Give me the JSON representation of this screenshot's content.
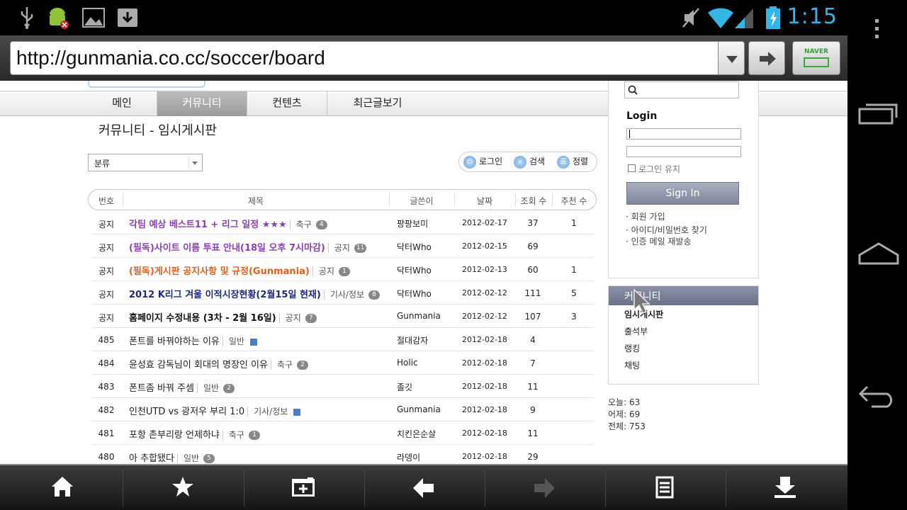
{
  "status_bar": {
    "time": "1:15",
    "icons": [
      "usb-icon",
      "android-debug-icon",
      "image-icon",
      "download-icon",
      "mute-icon",
      "wifi-icon",
      "signal-icon",
      "battery-charging-icon"
    ]
  },
  "url_bar": {
    "url": "http://gunmania.co.cc/soccer/board",
    "naver_label": "NAVER"
  },
  "nav": {
    "tabs": [
      {
        "label": "메인",
        "active": false
      },
      {
        "label": "커뮤니티",
        "active": true
      },
      {
        "label": "컨텐츠",
        "active": false
      },
      {
        "label": "최근글보기",
        "active": false
      }
    ]
  },
  "board": {
    "title": "커뮤니티 - 임시게시판",
    "category_select": "분류",
    "tools": {
      "login": "로그인",
      "search": "검색",
      "sort": "정렬"
    },
    "columns": {
      "no": "번호",
      "title": "제목",
      "author": "글쓴이",
      "date": "날짜",
      "views": "조회 수",
      "recommend": "추천 수"
    },
    "rows": [
      {
        "no": "공지",
        "title": "각팀 예상 베스트11 + 리그 일정 ★★★",
        "category": "축구",
        "comments": "4",
        "author": "팡팡보미",
        "date": "2012-02-17",
        "views": "37",
        "recommend": "1",
        "color": "#8a3fb5",
        "bold": true
      },
      {
        "no": "공지",
        "title": "(필독)사이트 이름 투표 안내(18일 오후 7시마감)",
        "category": "공지",
        "comments": "11",
        "author": "닥터Who",
        "date": "2012-02-15",
        "views": "69",
        "recommend": "",
        "color": "#8a3fb5",
        "bold": true
      },
      {
        "no": "공지",
        "title": "(필독)게시판 공지사항 및 규정(Gunmania)",
        "category": "공지",
        "comments": "1",
        "author": "닥터Who",
        "date": "2012-02-13",
        "views": "60",
        "recommend": "1",
        "color": "#e0601e",
        "bold": true
      },
      {
        "no": "공지",
        "title": "2012 K리그 겨울 이적시장현황(2월15일 현재)",
        "category": "기사/정보",
        "comments": "8",
        "author": "닥터Who",
        "date": "2012-02-12",
        "views": "111",
        "recommend": "5",
        "color": "#1e2a7a",
        "bold": true
      },
      {
        "no": "공지",
        "title": "홈페이지 수정내용 (3차 - 2월 16일)",
        "category": "공지",
        "comments": "7",
        "author": "Gunmania",
        "date": "2012-02-12",
        "views": "107",
        "recommend": "3",
        "color": "#111111",
        "bold": true
      },
      {
        "no": "485",
        "title": "폰트를 바꿔야하는 이유",
        "category": "일반",
        "comments": "",
        "file": true,
        "author": "절대감자",
        "date": "2012-02-18",
        "views": "4",
        "recommend": "",
        "color": "#222222",
        "bold": false
      },
      {
        "no": "484",
        "title": "윤성효 감독님이 회대의 명장인 이유",
        "category": "축구",
        "comments": "2",
        "author": "Holic",
        "date": "2012-02-18",
        "views": "7",
        "recommend": "",
        "color": "#222222",
        "bold": false
      },
      {
        "no": "483",
        "title": "폰트좀 바꿔 주셈",
        "category": "일반",
        "comments": "2",
        "author": "졸깃",
        "date": "2012-02-18",
        "views": "11",
        "recommend": "",
        "color": "#222222",
        "bold": false
      },
      {
        "no": "482",
        "title": "인천UTD vs 광저우 부리 1:0",
        "category": "기사/정보",
        "comments": "",
        "file": true,
        "author": "Gunmania",
        "date": "2012-02-18",
        "views": "9",
        "recommend": "",
        "color": "#222222",
        "bold": false
      },
      {
        "no": "481",
        "title": "포항 촌부리랑 언제하냐",
        "category": "축구",
        "comments": "1",
        "author": "치킨은순살",
        "date": "2012-02-18",
        "views": "11",
        "recommend": "",
        "color": "#222222",
        "bold": false
      },
      {
        "no": "480",
        "title": "아 추합됐다",
        "category": "일반",
        "comments": "5",
        "author": "라뎅이",
        "date": "2012-02-18",
        "views": "29",
        "recommend": "",
        "color": "#222222",
        "bold": false
      }
    ]
  },
  "sidebar": {
    "login_title": "Login",
    "remember_label": "로그인 유지",
    "signin_label": "Sign In",
    "links": [
      "회원 가입",
      "아이디/비밀번호 찾기",
      "인증 메일 재발송"
    ],
    "community_title": "커뮤니티",
    "community_items": [
      "임시게시판",
      "출석부",
      "랭킹",
      "채팅"
    ],
    "stats": [
      "오늘: 63",
      "어제: 69",
      "전체: 753"
    ]
  },
  "toolbar": {
    "buttons": [
      "home-icon",
      "bookmark-star-icon",
      "new-tab-icon",
      "back-icon",
      "forward-icon",
      "menu-list-icon",
      "download-icon"
    ]
  },
  "system_nav": [
    "overflow-menu-icon",
    "recent-apps-icon",
    "home-icon",
    "back-icon"
  ]
}
